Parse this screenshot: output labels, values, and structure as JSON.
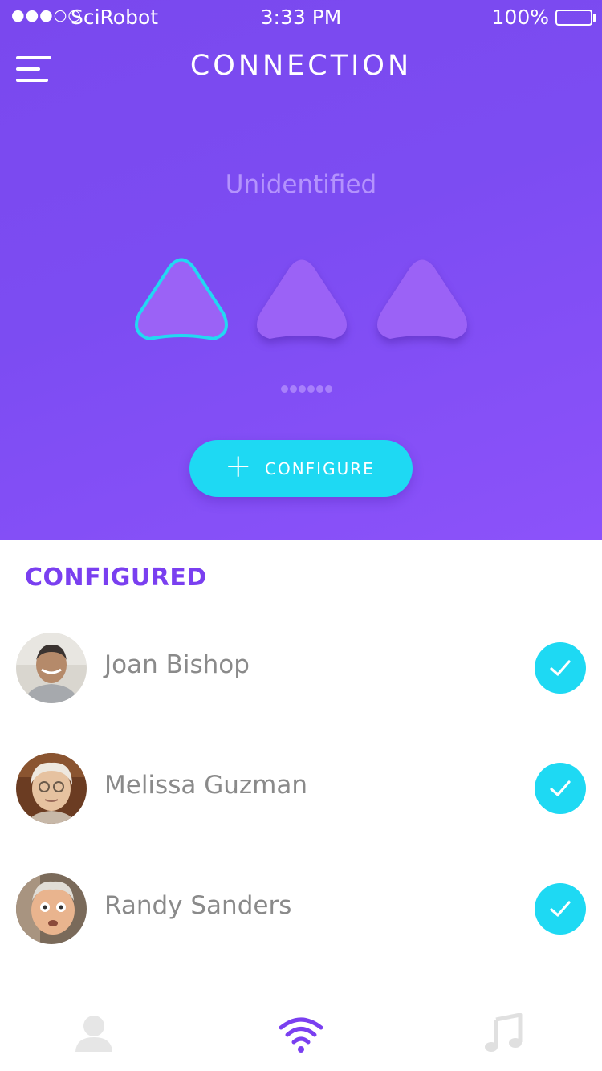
{
  "status_bar": {
    "signal": "●●●○○",
    "carrier": "SciRobot",
    "time": "3:33 PM",
    "battery": "100%"
  },
  "header": {
    "title": "CONNECTION"
  },
  "device": {
    "name": "Unidentified"
  },
  "configure_button": {
    "label": "CONFIGURE",
    "icon": "+"
  },
  "configured": {
    "title": "CONFIGURED",
    "contacts": [
      {
        "name": "Joan Bishop"
      },
      {
        "name": "Melissa Guzman"
      },
      {
        "name": "Randy Sanders"
      }
    ]
  },
  "colors": {
    "accent_purple": "#7a3ff0",
    "accent_cyan": "#1ed9f3",
    "text_gray": "#8a8a8a"
  },
  "icons": {
    "menu": "menu-icon",
    "add": "plus-icon",
    "check": "check-icon",
    "tab_profile": "person-icon",
    "tab_connection": "wifi-icon",
    "tab_music": "music-note-icon"
  }
}
